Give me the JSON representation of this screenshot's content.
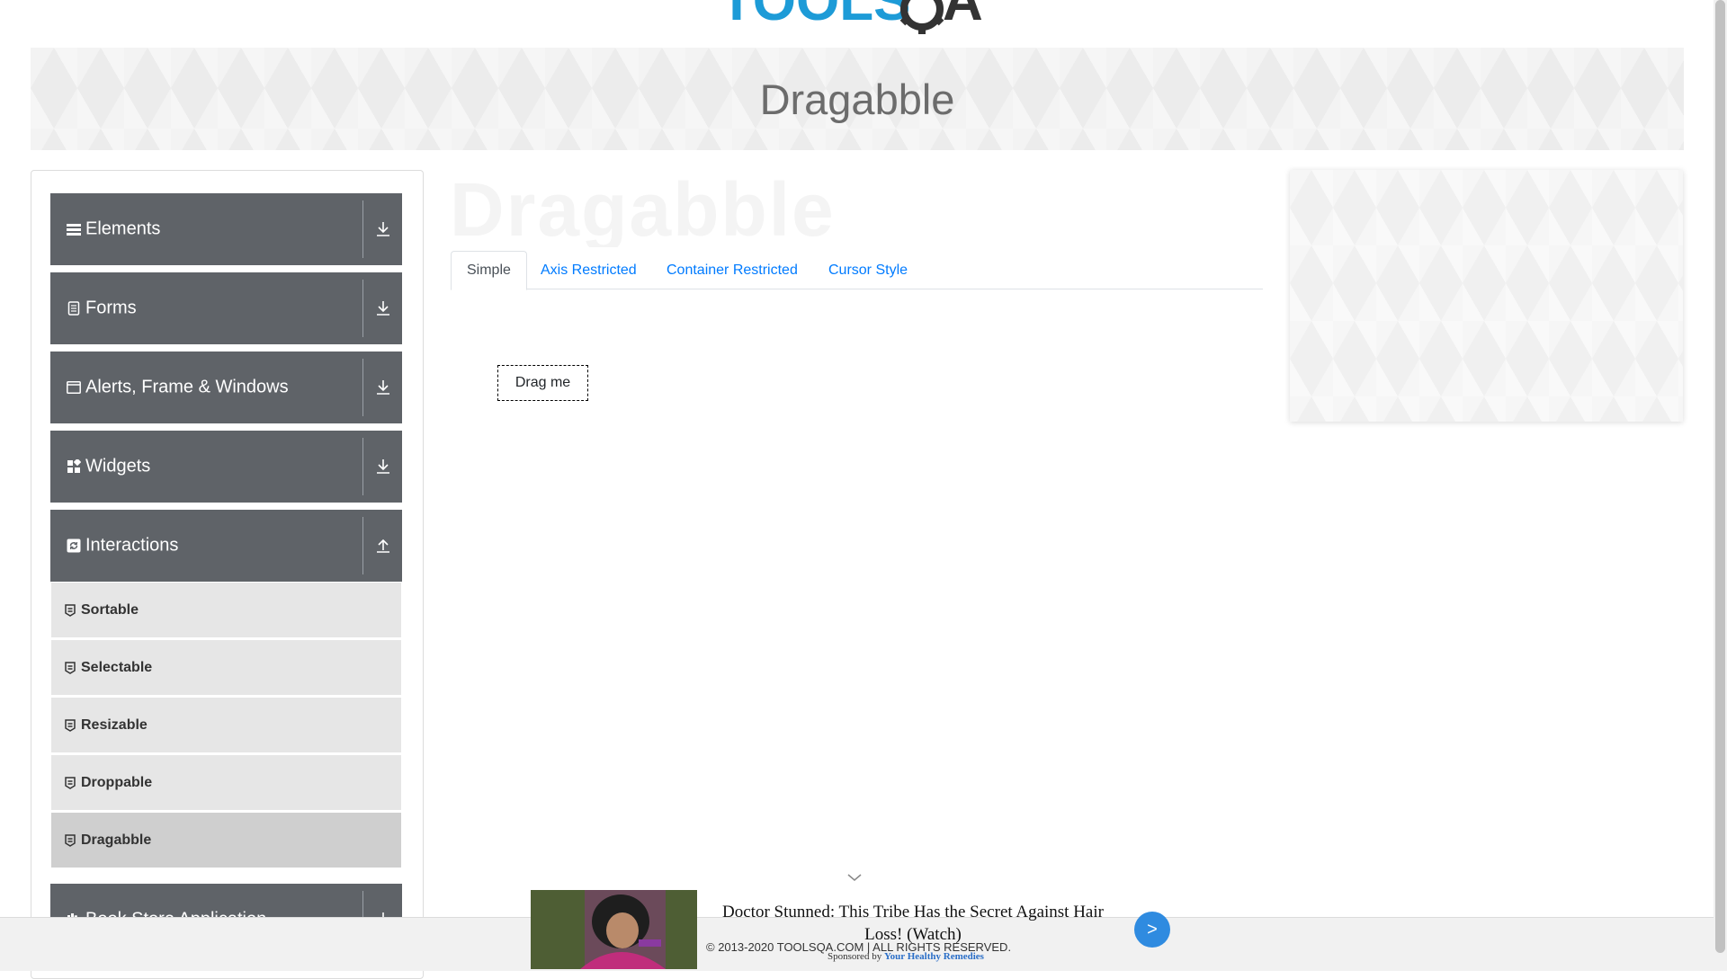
{
  "logo": {
    "text": "TOOLSQA"
  },
  "banner": {
    "title": "Dragabble"
  },
  "ghost_text": "Dragabble",
  "sidebar": {
    "groups": [
      {
        "label": "Elements",
        "icon": "bars-icon",
        "state": "collapsed"
      },
      {
        "label": "Forms",
        "icon": "document-icon",
        "state": "collapsed"
      },
      {
        "label": "Alerts, Frame & Windows",
        "icon": "window-icon",
        "state": "collapsed"
      },
      {
        "label": "Widgets",
        "icon": "grid-icon",
        "state": "collapsed"
      },
      {
        "label": "Interactions",
        "icon": "refresh-icon",
        "state": "expanded"
      },
      {
        "label": "Book Store Application",
        "icon": "books-icon",
        "state": "collapsed"
      }
    ],
    "interactions_items": [
      {
        "label": "Sortable",
        "active": false
      },
      {
        "label": "Selectable",
        "active": false
      },
      {
        "label": "Resizable",
        "active": false
      },
      {
        "label": "Droppable",
        "active": false
      },
      {
        "label": "Dragabble",
        "active": true
      }
    ]
  },
  "tabs": [
    {
      "label": "Simple",
      "active": true
    },
    {
      "label": "Axis Restricted",
      "active": false
    },
    {
      "label": "Container Restricted",
      "active": false
    },
    {
      "label": "Cursor Style",
      "active": false
    }
  ],
  "draggable": {
    "label": "Drag me"
  },
  "footer": {
    "text": "© 2013-2020 TOOLSQA.COM | ALL RIGHTS RESERVED."
  },
  "bottom_ad": {
    "headline": "Doctor Stunned: This Tribe Has the Secret Against Hair Loss! (Watch)",
    "sponsored_prefix": "Sponsored by",
    "sponsor": "Your Healthy Remedies",
    "next_label": ">"
  },
  "colors": {
    "sidebar_header": "#5f6368",
    "sub_item": "#e6e6e6",
    "sub_item_active": "#cfcfcf",
    "tab_link": "#007bff",
    "logo_blue": "#1d9bd7",
    "logo_dark": "#333333"
  }
}
